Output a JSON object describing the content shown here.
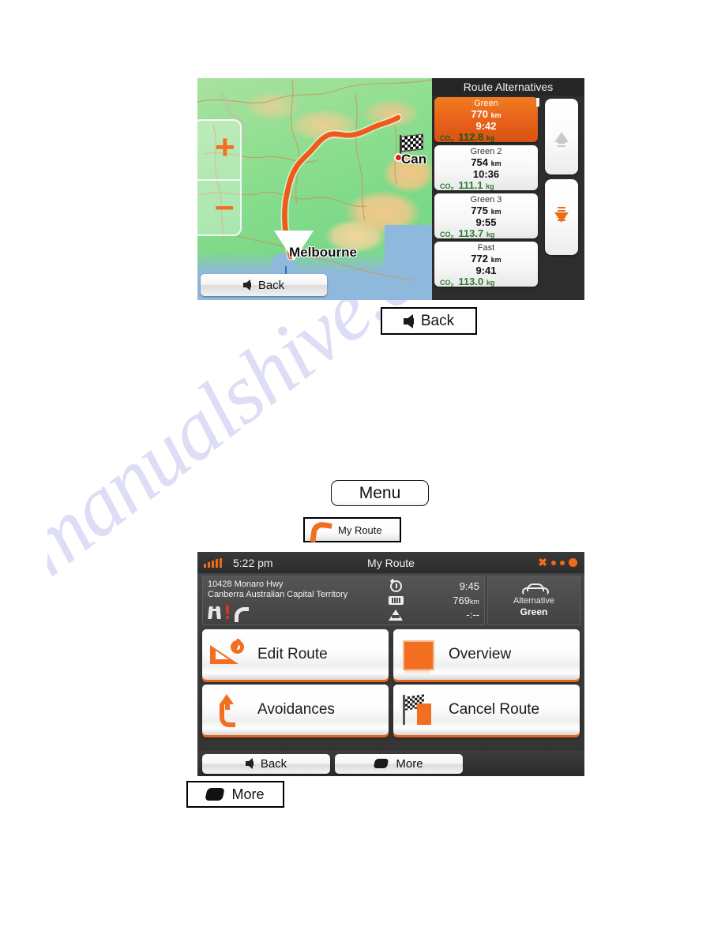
{
  "watermark": {
    "text": "manualshive.com"
  },
  "top_device": {
    "map": {
      "zoom_in_label": "+",
      "zoom_out_label": "–",
      "labels": {
        "origin": "Melbourne",
        "destination": "Can"
      },
      "back_button": "Back"
    },
    "alternatives": {
      "title": "Route Alternatives",
      "co2_label": "CO",
      "co2_sub": "2",
      "items": [
        {
          "name": "Green",
          "distance": "770",
          "distance_unit": "km",
          "time": "9:42",
          "co2": "112.8",
          "co2_unit": "kg",
          "selected": true
        },
        {
          "name": "Green 2",
          "distance": "754",
          "distance_unit": "km",
          "time": "10:36",
          "co2": "111.1",
          "co2_unit": "kg",
          "selected": false
        },
        {
          "name": "Green 3",
          "distance": "775",
          "distance_unit": "km",
          "time": "9:55",
          "co2": "113.7",
          "co2_unit": "kg",
          "selected": false
        },
        {
          "name": "Fast",
          "distance": "772",
          "distance_unit": "km",
          "time": "9:41",
          "co2": "113.0",
          "co2_unit": "kg",
          "selected": false
        }
      ],
      "scroll_up_icon": "scroll-up-icon",
      "scroll_down_icon": "scroll-down-icon"
    }
  },
  "callouts": {
    "back": "Back",
    "menu": "Menu",
    "my_route": "My Route",
    "more": "More"
  },
  "bottom_device": {
    "status_bar": {
      "clock": "5:22 pm",
      "title": "My Route"
    },
    "route_info": {
      "address_line1": "10428 Monaro Hwy",
      "address_line2": "Canberra Australian Capital Territory",
      "road_icons": [
        "motorway-icon",
        "alert-icon",
        "curve-icon"
      ],
      "stats": [
        {
          "icon": "clock-icon",
          "value": "9:45",
          "unit": ""
        },
        {
          "icon": "odometer-icon",
          "value": "769",
          "unit": "km"
        },
        {
          "icon": "warning-icon",
          "value": "-:--",
          "unit": ""
        }
      ],
      "vehicle": {
        "icon": "car-icon",
        "label": "Alternative",
        "value": "Green"
      }
    },
    "menu_buttons": [
      {
        "label": "Edit Route",
        "icon": "edit-route-icon"
      },
      {
        "label": "Overview",
        "icon": "overview-icon"
      },
      {
        "label": "Avoidances",
        "icon": "avoidances-icon"
      },
      {
        "label": "Cancel Route",
        "icon": "cancel-route-icon"
      }
    ],
    "bottom_bar": {
      "back": "Back",
      "more": "More"
    }
  },
  "colors": {
    "accent_orange": "#f26f21",
    "co2_green": "#2e7d32",
    "device_dark": "#2d2d2d"
  }
}
